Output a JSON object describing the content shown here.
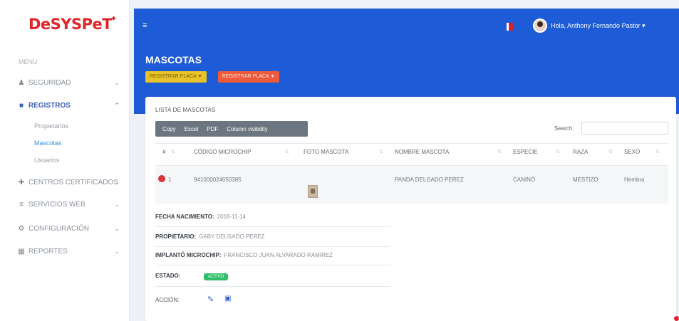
{
  "brand": {
    "logo": "DeSYSPeT",
    "color": "#e0262a"
  },
  "sidebar": {
    "caption": "MENU",
    "items": [
      {
        "icon": "user-icon",
        "label": "SEGURIDAD",
        "active": false
      },
      {
        "icon": "clipboard-icon",
        "label": "REGISTROS",
        "active": true
      },
      {
        "icon": "hospital-icon",
        "label": "CENTROS CERTIFICADOS",
        "active": false
      },
      {
        "icon": "list-icon",
        "label": "SERVICIOS WEB",
        "active": false
      },
      {
        "icon": "gear-icon",
        "label": "CONFIGURACIÓN",
        "active": false
      },
      {
        "icon": "chart-icon",
        "label": "REPORTES",
        "active": false
      }
    ],
    "subitems": [
      {
        "label": "Propietarios",
        "active": false
      },
      {
        "label": "Mascotas",
        "active": true
      },
      {
        "label": "Usuarios",
        "active": false
      }
    ]
  },
  "header": {
    "menu_toggle": "≡",
    "user_greeting": "Hola, Anthony Fernando Pastor ▾",
    "page_title": "MASCOTAS",
    "btn_primary": "REGISTRAR PLACA ▼",
    "btn_secondary": "REGISTRAR PLACA ▼",
    "accent": "#1e5bd6"
  },
  "card": {
    "title": "LISTA DE MASCOTAS",
    "export_buttons": [
      "Copy",
      "Excel",
      "PDF",
      "Column visibility"
    ],
    "search_label": "Search:",
    "search_value": "",
    "columns": [
      "#",
      "CÓDIGO MICROCHIP",
      "FOTO MASCOTA",
      "NOMBRE MASCOTA",
      "ESPECIE",
      "RAZA",
      "SEXO"
    ],
    "row": {
      "index": "1",
      "microchip": "941000024050385",
      "name": "PANDA DELGADO PEREZ",
      "species": "CANINO",
      "breed": "MESTIZO",
      "sex": "Hembra"
    },
    "details": {
      "birth_label": "FECHA NACIMIENTO:",
      "birth_value": "2018-11-14",
      "owner_label": "PROPIETARIO:",
      "owner_value": "GABY DELGADO PEREZ",
      "implant_label": "IMPLANTÓ MICROCHIP:",
      "implant_value": "FRANCISCO JUAN ALVARADO RAMIREZ",
      "status_label": "ESTADO:",
      "status_value": "ACTIVO",
      "action_label": "ACCIÓN:"
    }
  }
}
